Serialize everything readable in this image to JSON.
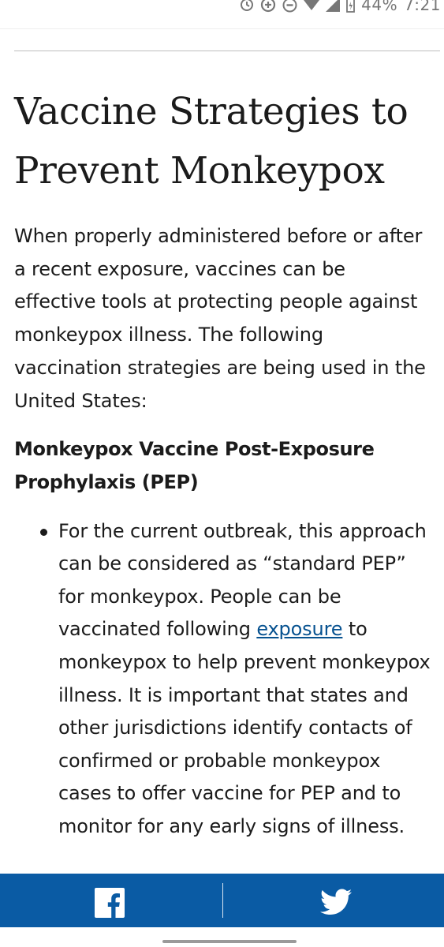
{
  "status_bar": {
    "battery": "44%",
    "time": "7:21"
  },
  "article": {
    "title": "Vaccine Strategies to Prevent Monkeypox",
    "intro": "When properly administered before or after a recent exposure, vaccines can be effective tools at protecting people against monkeypox illness. The following vaccination strategies are being used in the United States:",
    "subheading": "Monkeypox Vaccine Post-Exposure Prophylaxis (PEP)",
    "bullet": {
      "text_before": "For the current outbreak, this approach can be considered as “standard PEP” for monkeypox. People can be vaccinated following ",
      "link": "exposure",
      "text_after": " to monkeypox to help prevent monkeypox illness. It is important that states and other jurisdictions identify contacts of confirmed or probable monkeypox cases to offer vaccine for PEP and to monitor for any early signs of illness."
    }
  },
  "share_bar": {
    "background": "#0a5ba4",
    "link_color": "#075290",
    "icons": [
      "facebook-icon",
      "twitter-icon"
    ]
  }
}
